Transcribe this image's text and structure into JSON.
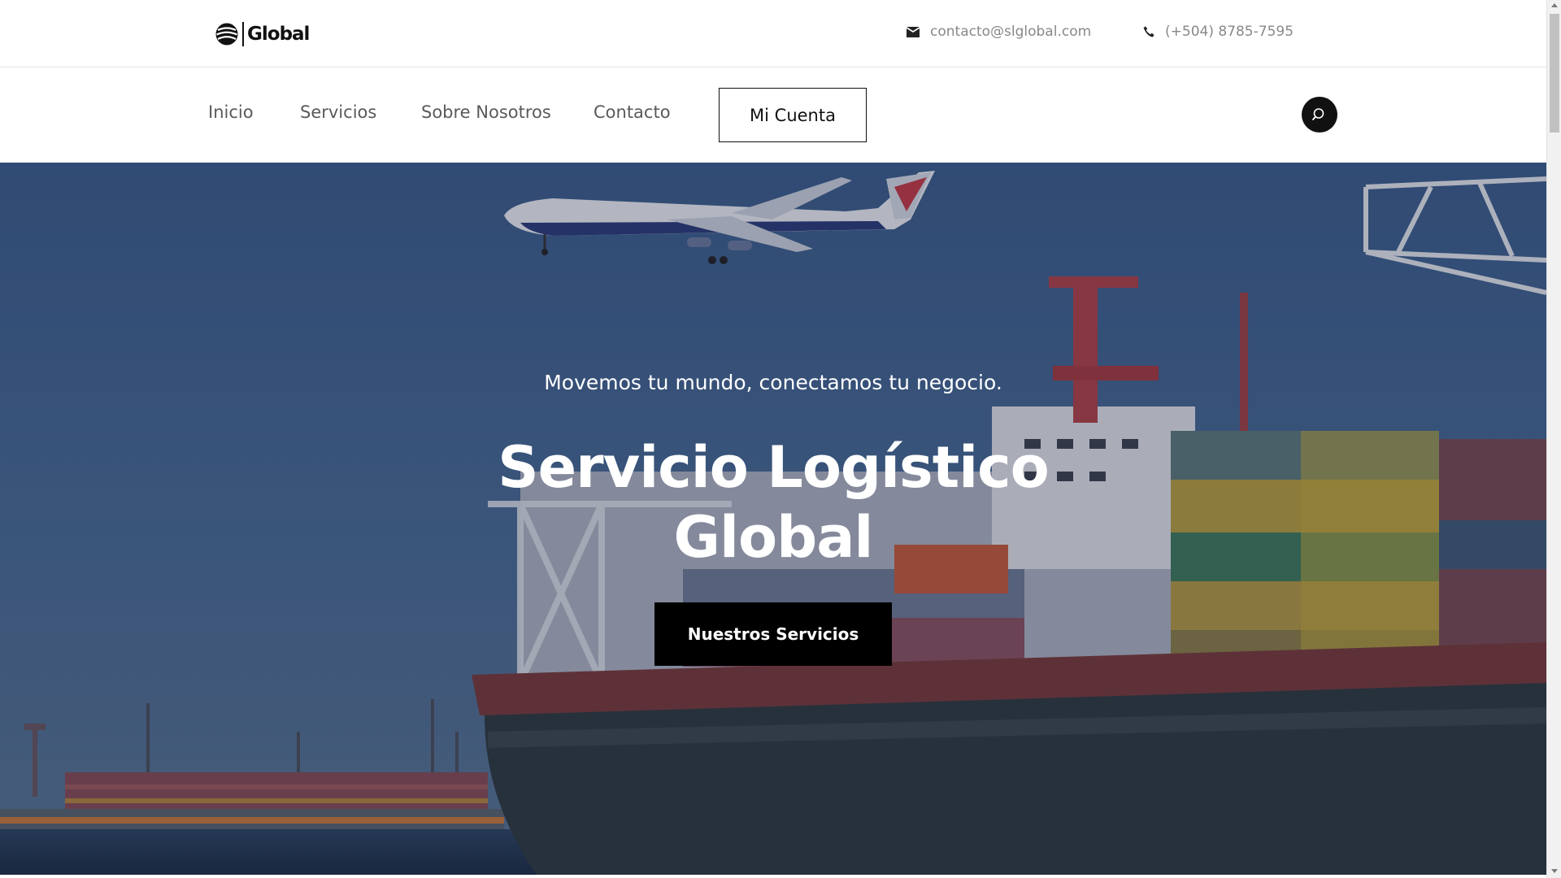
{
  "header": {
    "logo_text": "Global",
    "email": "contacto@slglobal.com",
    "phone": "(+504) 8785-7595"
  },
  "nav": {
    "items": [
      {
        "label": "Inicio"
      },
      {
        "label": "Servicios"
      },
      {
        "label": "Sobre Nosotros"
      },
      {
        "label": "Contacto"
      }
    ],
    "account_label": "Mi Cuenta"
  },
  "hero": {
    "tagline": "Movemos tu mundo, conectamos tu negocio.",
    "title_line1": "Servicio Logístico",
    "title_line2": "Global",
    "cta_label": "Nuestros Servicios"
  },
  "colors": {
    "accent": "#000000",
    "text_muted": "#888888",
    "nav_text": "#5a5a5a"
  },
  "icons": {
    "email": "envelope-icon",
    "phone": "phone-icon",
    "search": "search-icon"
  }
}
